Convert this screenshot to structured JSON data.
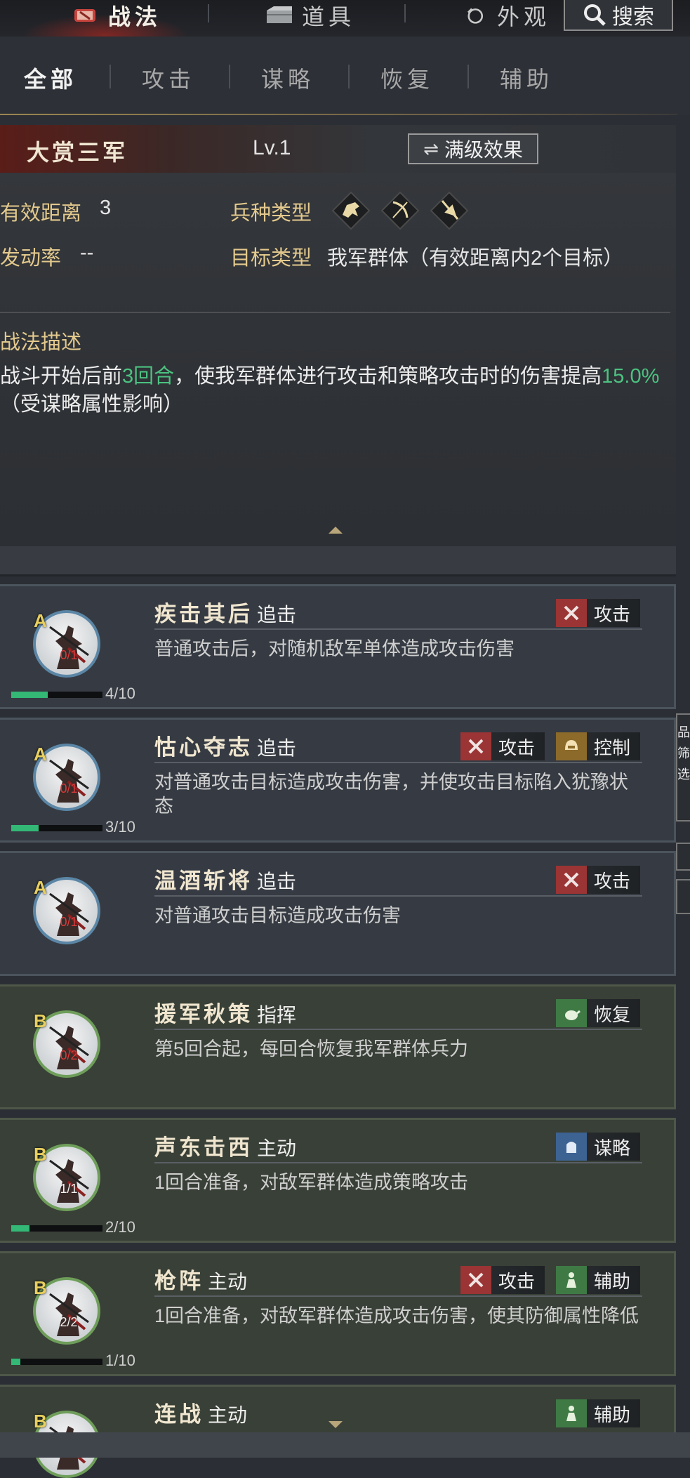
{
  "top_tabs": [
    {
      "label": "战法",
      "icon": "tactic-scroll-icon",
      "active": true
    },
    {
      "label": "道具",
      "icon": "item-chest-icon",
      "active": false
    },
    {
      "label": "外观",
      "icon": "appearance-icon",
      "active": false
    }
  ],
  "search": {
    "label": "搜索",
    "icon": "search-icon"
  },
  "filter_tabs": [
    "全部",
    "攻击",
    "谋略",
    "恢复",
    "辅助"
  ],
  "detail": {
    "name": "大赏三军",
    "level": "Lv.1",
    "max_effect_button": "满级效果",
    "range_label": "有效距离",
    "range_value": "3",
    "rate_label": "发动率",
    "rate_value": "--",
    "troop_label": "兵种类型",
    "troop_icons": [
      "cavalry-icon",
      "archer-icon",
      "spearman-icon"
    ],
    "target_label": "目标类型",
    "target_value": "我军群体（有效距离内2个目标）",
    "desc_title": "战法描述",
    "desc_part1": "战斗开始后前",
    "desc_highlight1": "3回合",
    "desc_part2": "，使我军群体进行攻击和策略攻击时的伤害提高",
    "desc_highlight2": "15.0%",
    "desc_part3": "（受谋略属性影响）"
  },
  "skills": [
    {
      "grade": "A",
      "name": "疾击其后",
      "kind": "追击",
      "count": "0/1",
      "progress_text": "4/10",
      "progress": 0.4,
      "tags": [
        {
          "label": "攻击",
          "icon": "attack-swords-icon",
          "color": "red"
        }
      ],
      "desc": "普通攻击后，对随机敌军单体造成攻击伤害"
    },
    {
      "grade": "A",
      "name": "怙心夺志",
      "kind": "追击",
      "count": "0/1",
      "progress_text": "3/10",
      "progress": 0.3,
      "tags": [
        {
          "label": "攻击",
          "icon": "attack-swords-icon",
          "color": "red"
        },
        {
          "label": "控制",
          "icon": "control-helmet-icon",
          "color": "gold"
        }
      ],
      "desc": "对普通攻击目标造成攻击伤害，并使攻击目标陷入犹豫状态"
    },
    {
      "grade": "A",
      "name": "温酒斩将",
      "kind": "追击",
      "count": "0/1",
      "progress_text": "",
      "progress": null,
      "tags": [
        {
          "label": "攻击",
          "icon": "attack-swords-icon",
          "color": "red"
        }
      ],
      "desc": "对普通攻击目标造成攻击伤害"
    },
    {
      "grade": "B",
      "name": "援军秋策",
      "kind": "指挥",
      "count": "0/2",
      "progress_text": "",
      "progress": null,
      "tags": [
        {
          "label": "恢复",
          "icon": "heal-teapot-icon",
          "color": "green"
        }
      ],
      "desc": "第5回合起，每回合恢复我军群体兵力"
    },
    {
      "grade": "B",
      "name": "声东击西",
      "kind": "主动",
      "count": "1/1",
      "progress_text": "2/10",
      "progress": 0.2,
      "tags": [
        {
          "label": "谋略",
          "icon": "strategy-hand-icon",
          "color": "blue"
        }
      ],
      "desc": "1回合准备，对敌军群体造成策略攻击"
    },
    {
      "grade": "B",
      "name": "枪阵",
      "kind": "主动",
      "count": "2/2",
      "progress_text": "1/10",
      "progress": 0.1,
      "tags": [
        {
          "label": "攻击",
          "icon": "attack-swords-icon",
          "color": "red"
        },
        {
          "label": "辅助",
          "icon": "support-figure-icon",
          "color": "green"
        }
      ],
      "desc": "1回合准备，对敌军群体造成攻击伤害，使其防御属性降低"
    },
    {
      "grade": "B",
      "name": "连战",
      "kind": "主动",
      "count": "",
      "progress_text": "",
      "progress": null,
      "tags": [
        {
          "label": "辅助",
          "icon": "support-figure-icon",
          "color": "green"
        }
      ],
      "desc": ""
    }
  ],
  "side_tab_text": "品 筛 选",
  "colors": {
    "accent_gold": "#e3c98d",
    "highlight_green": "#4cc281",
    "attack_red": "#9b3434"
  }
}
